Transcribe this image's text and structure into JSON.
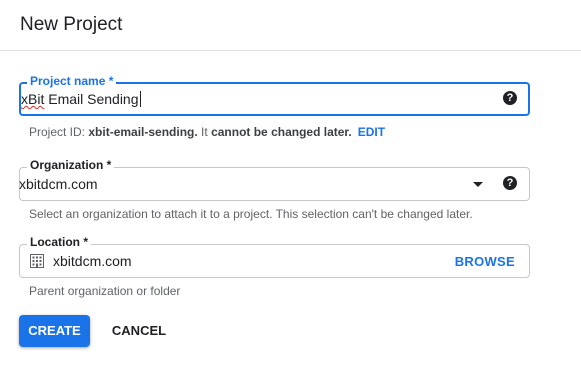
{
  "dialog": {
    "title": "New Project"
  },
  "project_name": {
    "label": "Project name *",
    "value_word1": "xBit",
    "value_rest": " Email Sending",
    "help_icon": "help-circle-icon"
  },
  "project_id": {
    "prefix": "Project ID: ",
    "id": "xbit-email-sending.",
    "suffix": " It ",
    "note": "cannot be changed later.",
    "edit_label": "EDIT"
  },
  "organization": {
    "label": "Organization *",
    "value": "xbitdcm.com",
    "helper": "Select an organization to attach it to a project. This selection can't be changed later.",
    "dropdown_icon": "arrow-drop-down-icon",
    "help_icon": "help-circle-icon"
  },
  "location": {
    "label": "Location *",
    "value": "xbitdcm.com",
    "browse_label": "BROWSE",
    "helper": "Parent organization or folder",
    "icon": "building-icon"
  },
  "actions": {
    "create_label": "CREATE",
    "cancel_label": "CANCEL"
  },
  "colors": {
    "accent": "#1a73e8",
    "text": "#202124",
    "muted": "#5f6368"
  }
}
